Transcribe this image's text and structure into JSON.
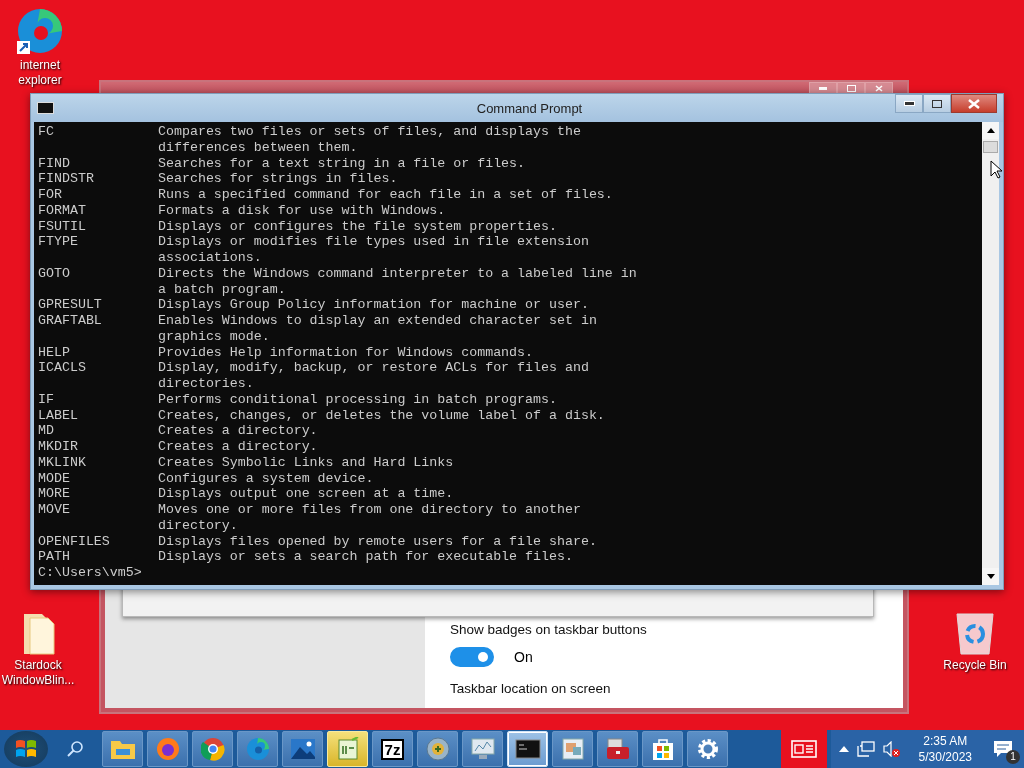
{
  "desktop_icons": [
    {
      "kind": "edge",
      "label": "internet\nexplorer"
    },
    {
      "kind": "folder",
      "label": "Stardock\nWindowBlin..."
    },
    {
      "kind": "recycle",
      "label": "Recycle Bin"
    }
  ],
  "settings_window": {
    "setting_label": "Show badges on taskbar buttons",
    "toggle": {
      "on": true,
      "label": "On"
    },
    "next_label": "Taskbar location on screen"
  },
  "console_window": {
    "title": "Command Prompt",
    "entries": [
      {
        "command": "FC",
        "lines": [
          "Compares two files or sets of files, and displays the",
          "differences between them."
        ]
      },
      {
        "command": "FIND",
        "lines": [
          "Searches for a text string in a file or files."
        ]
      },
      {
        "command": "FINDSTR",
        "lines": [
          "Searches for strings in files."
        ]
      },
      {
        "command": "FOR",
        "lines": [
          "Runs a specified command for each file in a set of files."
        ]
      },
      {
        "command": "FORMAT",
        "lines": [
          "Formats a disk for use with Windows."
        ]
      },
      {
        "command": "FSUTIL",
        "lines": [
          "Displays or configures the file system properties."
        ]
      },
      {
        "command": "FTYPE",
        "lines": [
          "Displays or modifies file types used in file extension",
          "associations."
        ]
      },
      {
        "command": "GOTO",
        "lines": [
          "Directs the Windows command interpreter to a labeled line in",
          "a batch program."
        ]
      },
      {
        "command": "GPRESULT",
        "lines": [
          "Displays Group Policy information for machine or user."
        ]
      },
      {
        "command": "GRAFTABL",
        "lines": [
          "Enables Windows to display an extended character set in",
          "graphics mode."
        ]
      },
      {
        "command": "HELP",
        "lines": [
          "Provides Help information for Windows commands."
        ]
      },
      {
        "command": "ICACLS",
        "lines": [
          "Display, modify, backup, or restore ACLs for files and",
          "directories."
        ]
      },
      {
        "command": "IF",
        "lines": [
          "Performs conditional processing in batch programs."
        ]
      },
      {
        "command": "LABEL",
        "lines": [
          "Creates, changes, or deletes the volume label of a disk."
        ]
      },
      {
        "command": "MD",
        "lines": [
          "Creates a directory."
        ]
      },
      {
        "command": "MKDIR",
        "lines": [
          "Creates a directory."
        ]
      },
      {
        "command": "MKLINK",
        "lines": [
          "Creates Symbolic Links and Hard Links"
        ]
      },
      {
        "command": "MODE",
        "lines": [
          "Configures a system device."
        ]
      },
      {
        "command": "MORE",
        "lines": [
          "Displays output one screen at a time."
        ]
      },
      {
        "command": "MOVE",
        "lines": [
          "Moves one or more files from one directory to another",
          "directory."
        ]
      },
      {
        "command": "OPENFILES",
        "lines": [
          "Displays files opened by remote users for a file share."
        ]
      },
      {
        "command": "PATH",
        "lines": [
          "Displays or sets a search path for executable files."
        ]
      }
    ],
    "prompt": "C:\\Users\\vm5>"
  },
  "taskbar": {
    "buttons": [
      {
        "kind": "explorer",
        "selected": false,
        "highlight": false
      },
      {
        "kind": "firefox",
        "selected": false,
        "highlight": false
      },
      {
        "kind": "chrome",
        "selected": false,
        "highlight": false
      },
      {
        "kind": "edge",
        "selected": false,
        "highlight": false
      },
      {
        "kind": "photos",
        "selected": false,
        "highlight": false
      },
      {
        "kind": "notepad",
        "selected": false,
        "highlight": true
      },
      {
        "kind": "archive",
        "label": "7z",
        "selected": false,
        "highlight": false
      },
      {
        "kind": "disc",
        "selected": false,
        "highlight": false
      },
      {
        "kind": "monitor",
        "selected": false,
        "highlight": false
      },
      {
        "kind": "console",
        "selected": true,
        "highlight": false
      },
      {
        "kind": "picture",
        "selected": false,
        "highlight": false
      },
      {
        "kind": "toolbox",
        "selected": false,
        "highlight": false
      },
      {
        "kind": "store",
        "selected": false,
        "highlight": false
      },
      {
        "kind": "gear",
        "selected": false,
        "highlight": false
      }
    ],
    "time": "2:35 AM",
    "date": "5/30/2023",
    "notification_count": "1"
  }
}
